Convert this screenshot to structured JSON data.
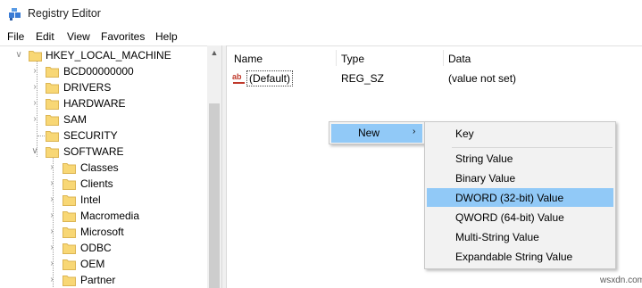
{
  "window": {
    "title": "Registry Editor",
    "icon": "regedit-icon"
  },
  "menu": [
    "File",
    "Edit",
    "View",
    "Favorites",
    "Help"
  ],
  "tree": {
    "root": "HKEY_LOCAL_MACHINE",
    "items": [
      {
        "label": "BCD00000000"
      },
      {
        "label": "DRIVERS"
      },
      {
        "label": "HARDWARE"
      },
      {
        "label": "SAM"
      },
      {
        "label": "SECURITY"
      },
      {
        "label": "SOFTWARE"
      }
    ],
    "software_children": [
      {
        "label": "Classes"
      },
      {
        "label": "Clients"
      },
      {
        "label": "Intel"
      },
      {
        "label": "Macromedia"
      },
      {
        "label": "Microsoft"
      },
      {
        "label": "ODBC"
      },
      {
        "label": "OEM"
      },
      {
        "label": "Partner"
      }
    ]
  },
  "list": {
    "columns": [
      "Name",
      "Type",
      "Data"
    ],
    "rows": [
      {
        "name": "(Default)",
        "type": "REG_SZ",
        "data": "(value not set)"
      }
    ]
  },
  "context_menu": {
    "item": "New",
    "submenu": {
      "first": "Key",
      "items": [
        "String Value",
        "Binary Value",
        "DWORD (32-bit) Value",
        "QWORD (64-bit) Value",
        "Multi-String Value",
        "Expandable String Value"
      ],
      "highlighted": "DWORD (32-bit) Value"
    }
  },
  "watermark": "wsxdn.com",
  "colors": {
    "highlight": "#91c9f7",
    "folder": "#f8d775",
    "folder_edge": "#dcb553"
  }
}
